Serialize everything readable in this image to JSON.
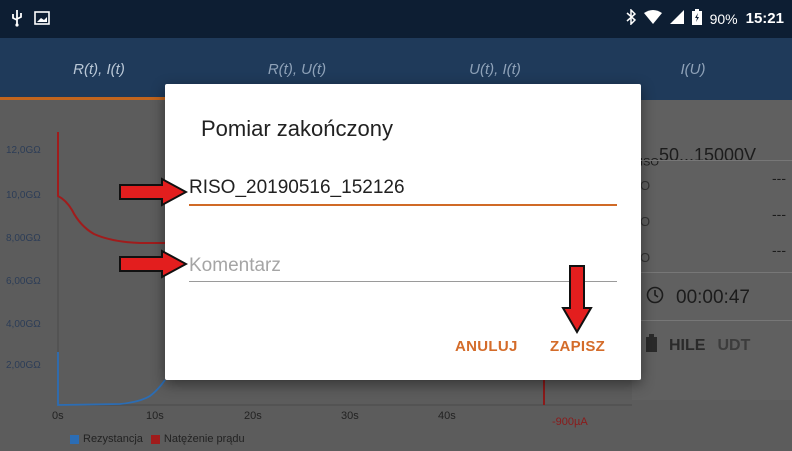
{
  "status_bar": {
    "battery": "90%",
    "time": "15:21",
    "icons": [
      "usb-icon",
      "image-icon",
      "bluetooth-icon",
      "wifi-icon",
      "signal-icon",
      "battery-icon"
    ]
  },
  "tabs": [
    {
      "label": "R(t), I(t)",
      "active": true
    },
    {
      "label": "R(t), U(t)",
      "active": false
    },
    {
      "label": "U(t), I(t)",
      "active": false
    },
    {
      "label": "I(U)",
      "active": false
    }
  ],
  "chart": {
    "y_ticks": [
      "12,0GΩ",
      "10,0GΩ",
      "8,00GΩ",
      "6,00GΩ",
      "4,00GΩ",
      "2,00GΩ"
    ],
    "x_ticks": [
      "0s",
      "10s",
      "20s",
      "30s",
      "40s"
    ],
    "current_label": "-900µA",
    "legend": [
      "Rezystancja",
      "Natężenie prądu"
    ],
    "colors": {
      "resistance": "#2b6db5",
      "current": "#a01c1c"
    }
  },
  "right_panel": {
    "title_sub": "ISO",
    "title_main": "50...15000V",
    "rows": [
      {
        "label": "O",
        "value": "---"
      },
      {
        "label": "O",
        "value": "---"
      },
      {
        "label": "O",
        "value": "---"
      }
    ],
    "timer": "00:00:47",
    "mode": "HILE",
    "udt": "UDT"
  },
  "dialog": {
    "title": "Pomiar zakończony",
    "name_value": "RISO_20190516_152126",
    "comment_placeholder": "Komentarz",
    "cancel_label": "ANULUJ",
    "save_label": "ZAPISZ"
  },
  "accent_color": "#d46c2a",
  "annotation_color": "#e31e1e"
}
